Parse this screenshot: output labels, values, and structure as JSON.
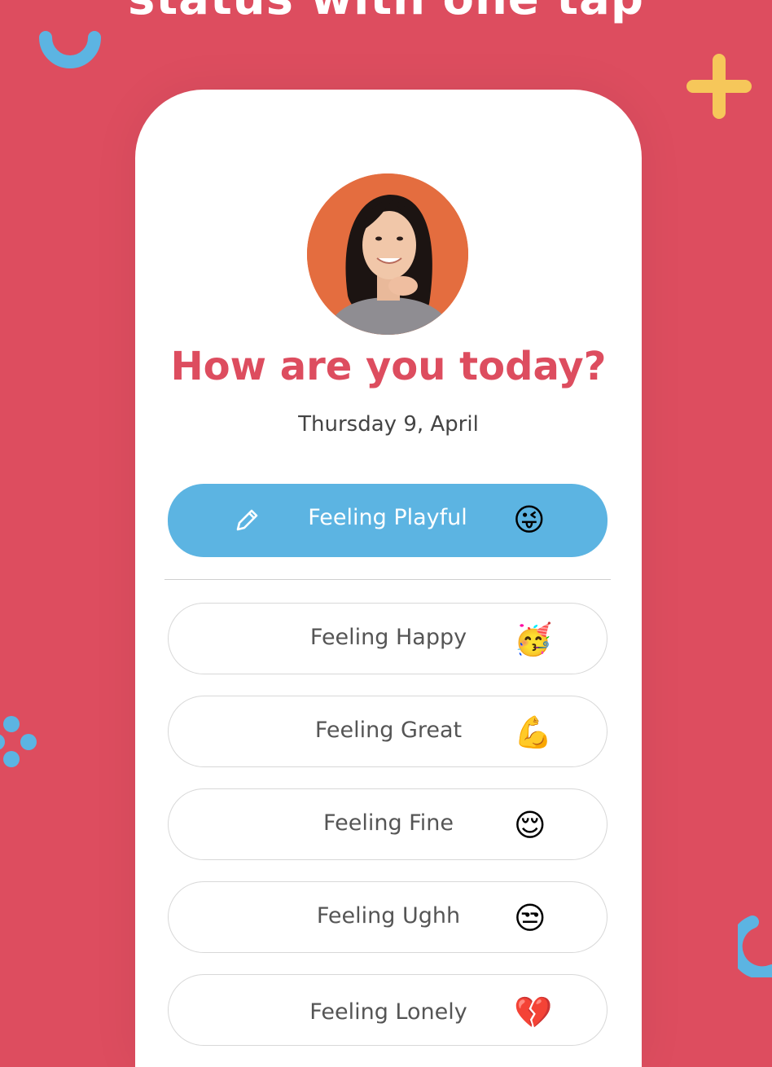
{
  "header": {
    "headline": "status with one tap"
  },
  "card": {
    "title": "How are you today?",
    "date": "Thursday 9, April"
  },
  "selected": {
    "label": "Feeling Playful",
    "emoji": "😜",
    "icon": "pencil-icon"
  },
  "options": [
    {
      "label": "Feeling Happy",
      "emoji": "🥳"
    },
    {
      "label": "Feeling Great",
      "emoji": "💪"
    },
    {
      "label": "Feeling Fine",
      "emoji": "😌"
    },
    {
      "label": "Feeling Ughh",
      "emoji": "😒"
    },
    {
      "label": "Feeling Lonely",
      "emoji": "💔"
    }
  ],
  "colors": {
    "background": "#dd4d5f",
    "accent_blue": "#5cb4e2",
    "accent_yellow": "#f6c75a",
    "avatar_bg": "#e46d3f"
  }
}
